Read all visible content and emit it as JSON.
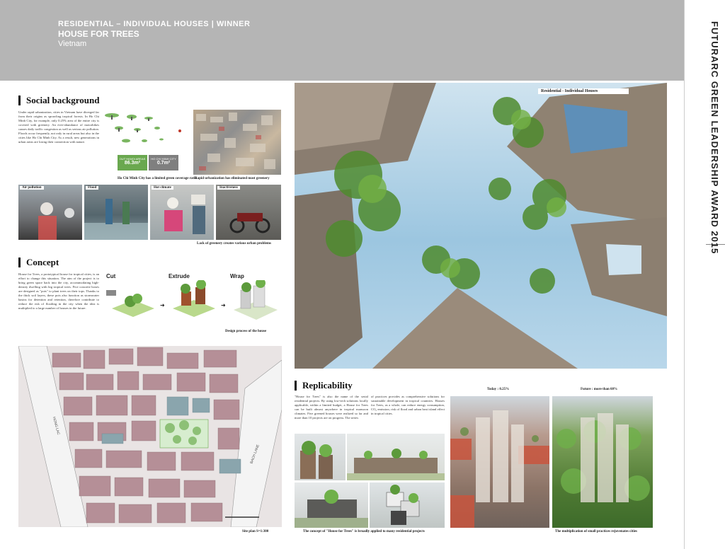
{
  "header": {
    "category": "RESIDENTIAL – INDIVIDUAL HOUSES",
    "separator": "|",
    "award": "WINNER",
    "title": "HOUSE FOR TREES",
    "location": "Vietnam"
  },
  "side_title": "FUTURARC GREEN LEADERSHIP AWARD 2015",
  "social": {
    "heading": "Social background",
    "text": "Under rapid urbanization, cities in Vietnam have diverged far from their origins as sprawling tropical forests. In Ho Chi Minh City, for example, only 0.25% area of the entire city is covered with greenery. An ever-abundance of motorbikes causes daily traffic congestion as well as serious air pollution. Floods occur frequently, not only in rural areas but also in the cities like Ho Chi Minh City. As a result, new generations in urban areas are losing their connection with nature.",
    "stat1_label": "OUT HANOI AREAS",
    "stat1_value": "86.3m²",
    "stat2_label": "HO CHI MINH CITY",
    "stat2_value": "0.7m²",
    "caption1": "Ho Chi Minh City has a limited green coverage ratio",
    "caption2": "Rapid urbanization has eliminated most greenery",
    "photos": [
      "Air pollution",
      "Flood",
      "Hot climate",
      "Inactiveness"
    ],
    "caption3": "Lack of greenery creates various urban problems"
  },
  "concept": {
    "heading": "Concept",
    "text": "House for Trees, a prototypical house for tropical cities, is an effort to change this situation. The aim of the project is to bring green space back into the city, accommodating high-density dwelling with big tropical trees. Five concrete boxes are designed as \"pots\" to plant trees on their tops. Thanks to the thick soil layers, these pots also function as stormwater basins for detention and retention, therefore contribute to reduce the risk of flooding in the city when the idea is multiplied to a large number of houses in the future.",
    "steps": [
      "Cut",
      "Extrude",
      "Wrap"
    ],
    "caption": "Design process of the house"
  },
  "site": {
    "caption": "Site plan S=1:300",
    "street1": "HONG LAC",
    "street2": "BACH LANE"
  },
  "main_photo": {
    "label": "Residential - Individual Houses"
  },
  "replicability": {
    "heading": "Replicability",
    "text1": "\"House for Trees\" is also the name of the serial residential projects. By using low-tech solutions locally applicable, within a limited budget, a House for Trees can be built almost anywhere in tropical monsoon climates. Five greened houses were realized so far and more than 10 projects are on progress. The series",
    "text2": "of practices provides as comprehensive solutions for sustainable development in tropical countries. Houses for Trees, as a whole, can reduce energy consumption, CO₂ emission, risk of flood and urban heat island effect in tropical cities.",
    "caption1": "The concept of \"House for Trees\" is broadly applied to many residential projects",
    "today_label": "Today : 0.25%",
    "future_label": "Future : more than 60%",
    "caption2": "The multiplication of small practices rejuvenates cities"
  },
  "colors": {
    "header_bg": "#b5b5b5",
    "accent_green": "#6aa84f"
  }
}
